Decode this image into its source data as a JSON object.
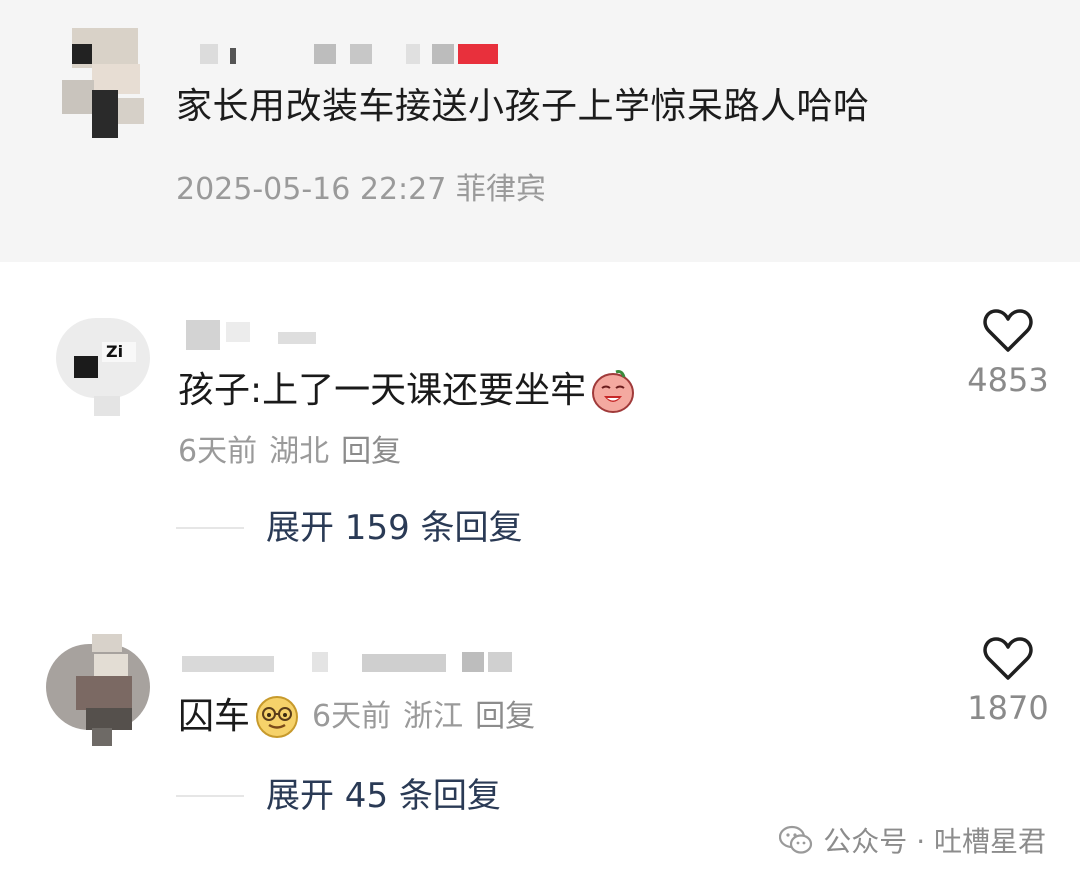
{
  "post": {
    "title": "家长用改装车接送小孩子上学惊呆路人哈哈",
    "timestamp": "2025-05-16 22:27",
    "location": "菲律宾",
    "author_avatar": "blurred-avatar"
  },
  "comments": [
    {
      "text": "孩子:上了一天课还要坐牢",
      "emoji": "crying-face-emoji",
      "time": "6天前",
      "location": "湖北",
      "reply_label": "回复",
      "likes": "4853",
      "expand_label": "展开 159 条回复",
      "avatar": "blurred-avatar"
    },
    {
      "text": "囚车",
      "emoji": "smiling-glasses-emoji",
      "time": "6天前",
      "location": "浙江",
      "reply_label": "回复",
      "likes": "1870",
      "expand_label": "展开 45 条回复",
      "avatar": "blurred-avatar"
    }
  ],
  "watermark": {
    "text": "公众号 · 吐槽星君",
    "icon": "wechat-icon"
  },
  "colors": {
    "header_bg": "#f5f5f5",
    "text_primary": "#1a1a1a",
    "text_secondary": "#9a9a9a",
    "expand_text": "#2a3a55",
    "name_redacted_accent": "#e8303c"
  }
}
